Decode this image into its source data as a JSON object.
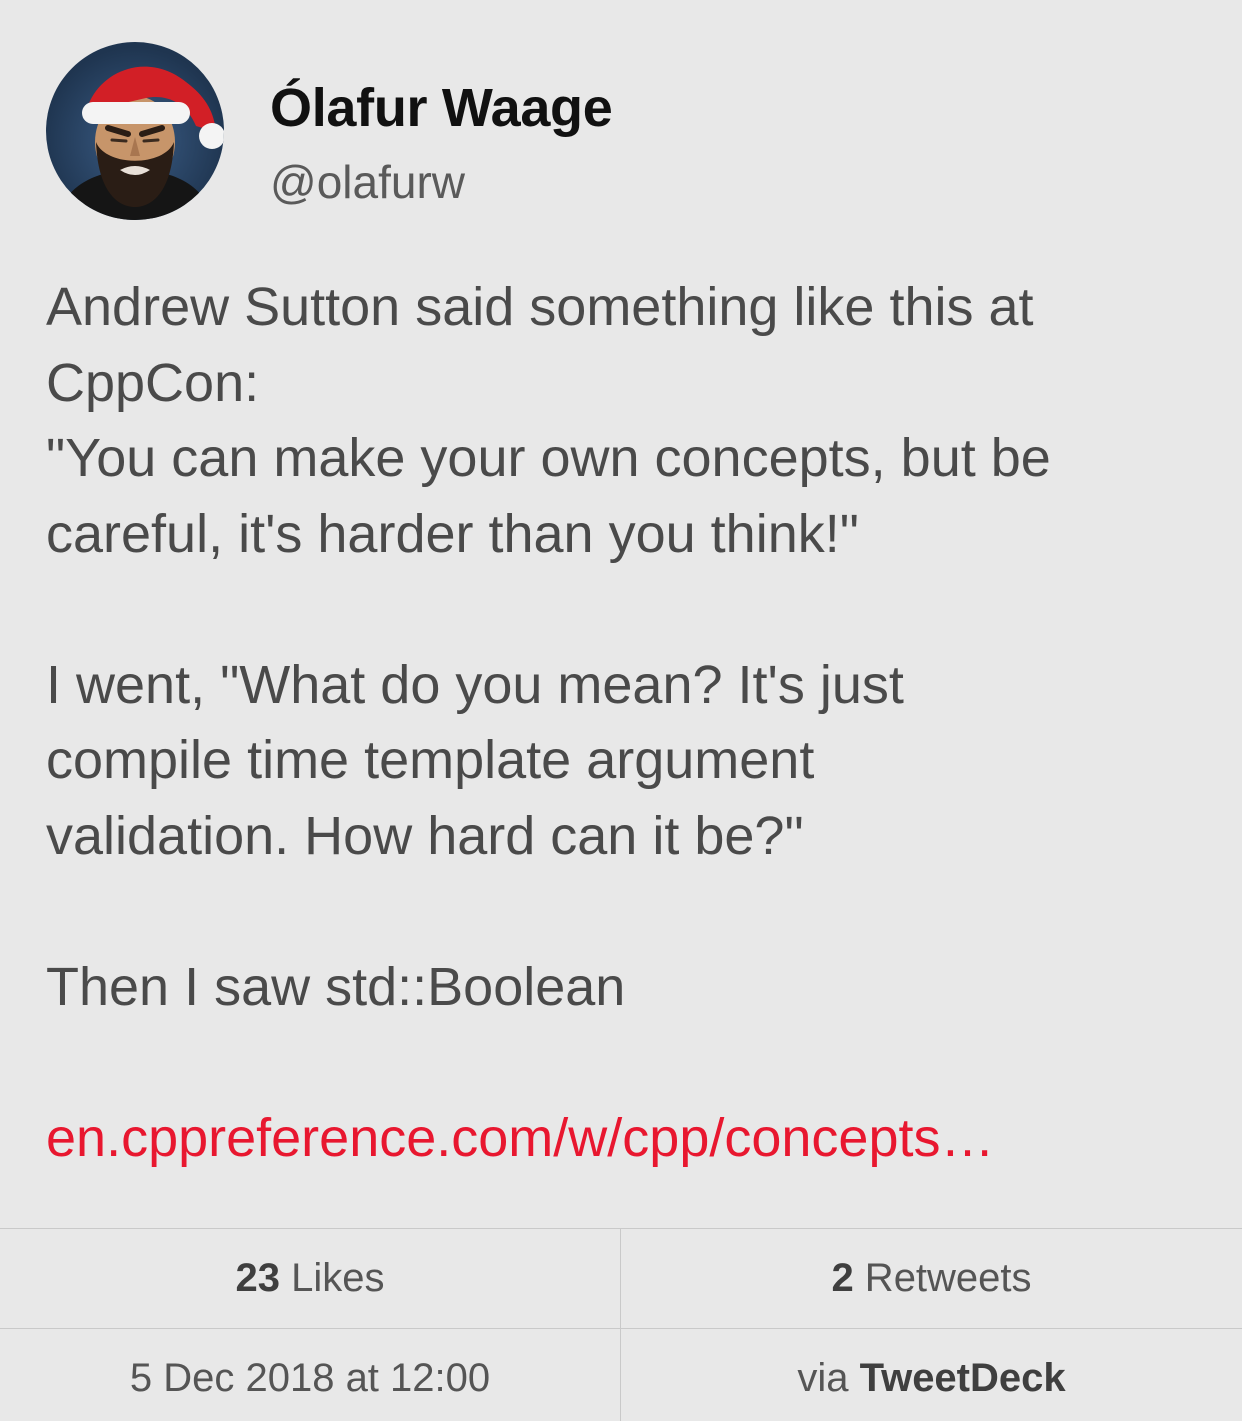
{
  "author": {
    "display_name": "Ólafur Waage",
    "handle": "@olafurw"
  },
  "tweet": {
    "lines": [
      "Andrew Sutton said something like this at",
      "CppCon:",
      "\"You can make your own concepts, but be",
      "careful, it's harder than you think!\"",
      "",
      "I went, \"What do you mean? It's just",
      "compile time template argument",
      "validation. How hard can it be?\"",
      "",
      "Then I saw std::Boolean",
      ""
    ],
    "link_text": "en.cppreference.com/w/cpp/concepts…"
  },
  "stats": {
    "likes_count": "23",
    "likes_label": " Likes",
    "retweets_count": "2",
    "retweets_label": " Retweets",
    "date": "5 Dec 2018 at 12:00",
    "via_prefix": "via ",
    "via_client": "TweetDeck"
  },
  "colors": {
    "background": "#e8e8e8",
    "link": "#e8172f",
    "text": "#4a4a4a",
    "name": "#111111",
    "divider": "#c9c9c9"
  },
  "icons": {
    "avatar": "santa-hat-avatar"
  }
}
